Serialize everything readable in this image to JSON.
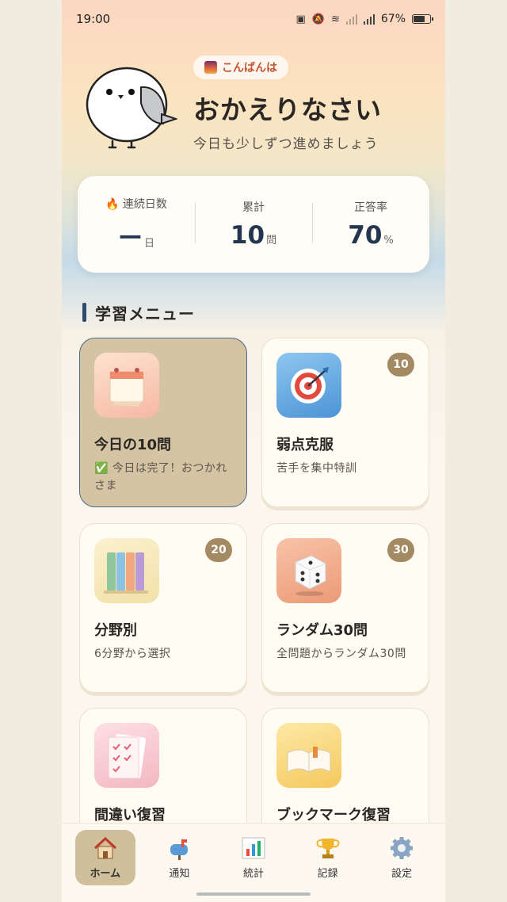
{
  "status": {
    "time": "19:00",
    "battery": "67%"
  },
  "header": {
    "greeting_badge": "こんばんは",
    "title": "おかえりなさい",
    "subtitle": "今日も少しずつ進めましょう"
  },
  "stats": [
    {
      "label": "🔥 連続日数",
      "value": "ー",
      "unit": "日"
    },
    {
      "label": "累計",
      "value": "10",
      "unit": "問"
    },
    {
      "label": "正答率",
      "value": "70",
      "unit": "%"
    }
  ],
  "section": {
    "title": "学習メニュー"
  },
  "menu": [
    {
      "name": "今日の10問",
      "desc": "✅ 今日は完了！おつかれさま",
      "count": "",
      "icon": "calendar-icon"
    },
    {
      "name": "弱点克服",
      "desc": "苦手を集中特訓",
      "count": "10",
      "icon": "target-icon"
    },
    {
      "name": "分野別",
      "desc": "6分野から選択",
      "count": "20",
      "icon": "books-icon"
    },
    {
      "name": "ランダム30問",
      "desc": "全問題からランダム30問",
      "count": "30",
      "icon": "dice-icon"
    },
    {
      "name": "間違い復習",
      "desc": "",
      "count": "",
      "icon": "checklist-icon"
    },
    {
      "name": "ブックマーク復習",
      "desc": "",
      "count": "",
      "icon": "open-book-icon"
    }
  ],
  "nav": [
    {
      "label": "ホーム",
      "icon": "house-icon",
      "active": true
    },
    {
      "label": "通知",
      "icon": "mailbox-icon"
    },
    {
      "label": "統計",
      "icon": "bar-chart-icon"
    },
    {
      "label": "記録",
      "icon": "trophy-icon"
    },
    {
      "label": "設定",
      "icon": "gear-icon"
    }
  ]
}
